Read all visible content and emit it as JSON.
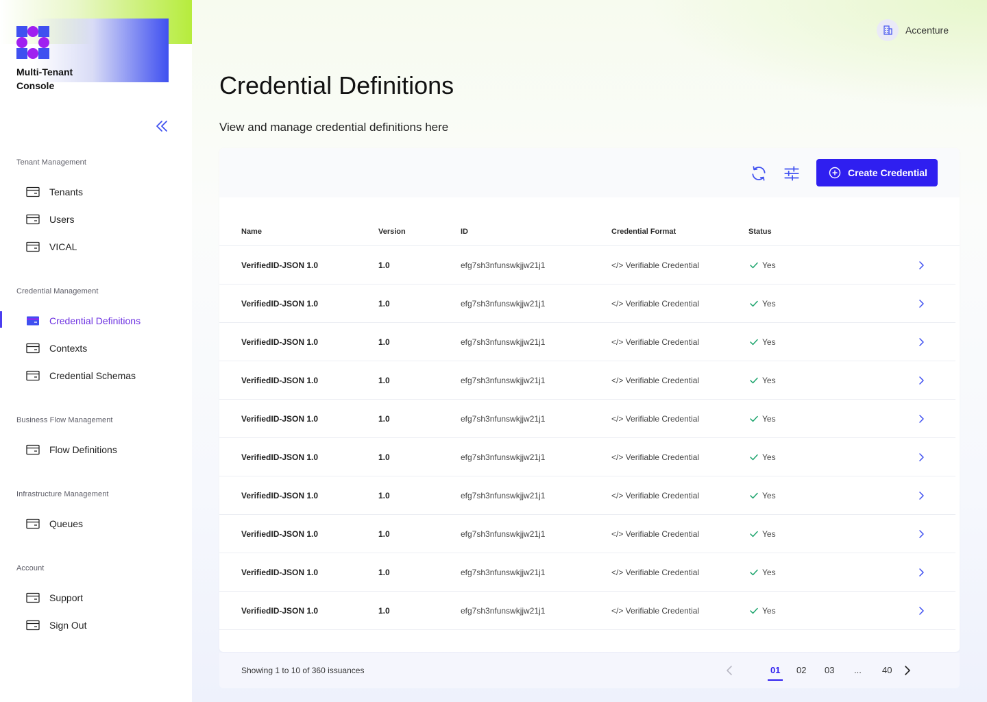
{
  "app": {
    "title": "Multi-Tenant Console",
    "brand_colors": {
      "primary": "#2f1ff0",
      "accent_purple": "#6b2fe0",
      "logo_blue": "#3f50f0",
      "logo_purple": "#a020f0",
      "lime": "#b6ec3c"
    }
  },
  "sidebar": {
    "collapse_icon": "double-chevron-left-icon",
    "sections": [
      {
        "title": "Tenant Management",
        "items": [
          {
            "label": "Tenants",
            "icon": "card-icon",
            "active": false
          },
          {
            "label": "Users",
            "icon": "card-icon",
            "active": false
          },
          {
            "label": "VICAL",
            "icon": "card-icon",
            "active": false
          }
        ]
      },
      {
        "title": "Credential Management",
        "items": [
          {
            "label": "Credential Definitions",
            "icon": "card-icon",
            "active": true
          },
          {
            "label": "Contexts",
            "icon": "card-icon",
            "active": false
          },
          {
            "label": "Credential Schemas",
            "icon": "card-icon",
            "active": false
          }
        ]
      },
      {
        "title": "Business Flow Management",
        "items": [
          {
            "label": "Flow Definitions",
            "icon": "card-icon",
            "active": false
          }
        ]
      },
      {
        "title": "Infrastructure Management",
        "items": [
          {
            "label": "Queues",
            "icon": "card-icon",
            "active": false
          }
        ]
      },
      {
        "title": "Account",
        "items": [
          {
            "label": "Support",
            "icon": "card-icon",
            "active": false
          },
          {
            "label": "Sign Out",
            "icon": "card-icon",
            "active": false
          }
        ]
      }
    ]
  },
  "header": {
    "org_name": "Accenture",
    "org_icon": "building-icon"
  },
  "page": {
    "title": "Credential Definitions",
    "subtitle": "View and manage credential definitions here"
  },
  "toolbar": {
    "refresh_icon": "refresh-icon",
    "filter_icon": "sliders-icon",
    "create_label": "Create Credential",
    "create_icon": "plus-circle-icon"
  },
  "table": {
    "columns": [
      "Name",
      "Version",
      "ID",
      "Credential Format",
      "Status"
    ],
    "rows": [
      {
        "name": "VerifiedID-JSON 1.0",
        "version": "1.0",
        "id": "efg7sh3nfunswkjjw21j1",
        "format": "</> Verifiable Credential",
        "status": "Yes"
      },
      {
        "name": "VerifiedID-JSON 1.0",
        "version": "1.0",
        "id": "efg7sh3nfunswkjjw21j1",
        "format": "</> Verifiable Credential",
        "status": "Yes"
      },
      {
        "name": "VerifiedID-JSON 1.0",
        "version": "1.0",
        "id": "efg7sh3nfunswkjjw21j1",
        "format": "</> Verifiable Credential",
        "status": "Yes"
      },
      {
        "name": "VerifiedID-JSON 1.0",
        "version": "1.0",
        "id": "efg7sh3nfunswkjjw21j1",
        "format": "</> Verifiable Credential",
        "status": "Yes"
      },
      {
        "name": "VerifiedID-JSON 1.0",
        "version": "1.0",
        "id": "efg7sh3nfunswkjjw21j1",
        "format": "</> Verifiable Credential",
        "status": "Yes"
      },
      {
        "name": "VerifiedID-JSON 1.0",
        "version": "1.0",
        "id": "efg7sh3nfunswkjjw21j1",
        "format": "</> Verifiable Credential",
        "status": "Yes"
      },
      {
        "name": "VerifiedID-JSON 1.0",
        "version": "1.0",
        "id": "efg7sh3nfunswkjjw21j1",
        "format": "</> Verifiable Credential",
        "status": "Yes"
      },
      {
        "name": "VerifiedID-JSON 1.0",
        "version": "1.0",
        "id": "efg7sh3nfunswkjjw21j1",
        "format": "</> Verifiable Credential",
        "status": "Yes"
      },
      {
        "name": "VerifiedID-JSON 1.0",
        "version": "1.0",
        "id": "efg7sh3nfunswkjjw21j1",
        "format": "</> Verifiable Credential",
        "status": "Yes"
      },
      {
        "name": "VerifiedID-JSON 1.0",
        "version": "1.0",
        "id": "efg7sh3nfunswkjjw21j1",
        "format": "</> Verifiable Credential",
        "status": "Yes"
      }
    ]
  },
  "pagination": {
    "summary": "Showing 1 to 10 of 360 issuances",
    "pages": [
      "01",
      "02",
      "03",
      "...",
      "40"
    ],
    "current": "01",
    "prev_icon": "chevron-left-icon",
    "next_icon": "chevron-right-icon"
  }
}
